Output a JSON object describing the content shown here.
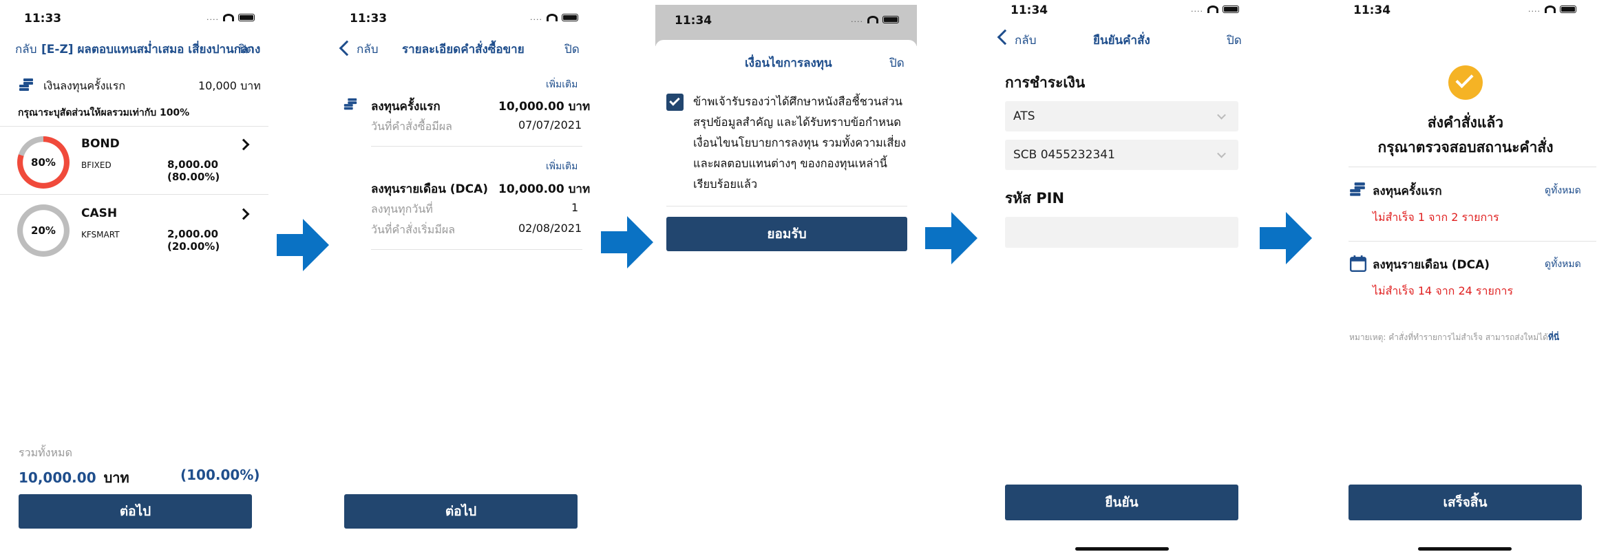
{
  "screen1": {
    "time": "11:33",
    "back": "กลับ",
    "title": "[E-Z] ผลตอบแทนสม่ำเสมอ เสี่ยงปานกลาง",
    "close": "ปิด",
    "initial_label": "เงินลงทุนครั้งแรก",
    "initial_value": "10,000 บาท",
    "instruction": "กรุณาระบุสัดส่วนให้ผลรวมเท่ากับ 100%",
    "funds": [
      {
        "name": "BOND",
        "code": "BFIXED",
        "amount": "8,000.00 (80.00%)",
        "percent_label": "80%",
        "fraction": 0.8,
        "color": "#f04a3b"
      },
      {
        "name": "CASH",
        "code": "KFSMART",
        "amount": "2,000.00 (20.00%)",
        "percent_label": "20%",
        "fraction": 0.2,
        "color": "#bdbdbd"
      }
    ],
    "total_label": "รวมทั้งหมด",
    "total_amount": "10,000.00",
    "total_unit": "บาท",
    "total_percent": "(100.00%)",
    "next_button": "ต่อไป"
  },
  "screen2": {
    "time": "11:33",
    "back": "กลับ",
    "title": "รายละเอียดคำสั่งซื้อขาย",
    "close": "ปิด",
    "more1": "เพิ่มเติม",
    "initial_title": "ลงทุนครั้งแรก",
    "initial_amount": "10,000.00 บาท",
    "initial_date_label": "วันที่คำสั่งซื้อมีผล",
    "initial_date": "07/07/2021",
    "more2": "เพิ่มเติม",
    "dca_title": "ลงทุนรายเดือน (DCA)",
    "dca_amount": "10,000.00 บาท",
    "dca_day_label": "ลงทุนทุกวันที่",
    "dca_day": "1",
    "dca_date_label": "วันที่คำสั่งเริ่มมีผล",
    "dca_date": "02/08/2021",
    "next_button": "ต่อไป"
  },
  "screen3": {
    "time": "11:34",
    "title": "เงื่อนไขการลงทุน",
    "close": "ปิด",
    "checked": true,
    "terms": [
      "ข้าพเจ้ารับรองว่าได้ศึกษาหนังสือชี้ชวนส่วน",
      "สรุปข้อมูลสำคัญ และได้รับทราบข้อกำหนด",
      "เงื่อนไขนโยบายการลงทุน รวมทั้งความเสี่ยง",
      "และผลตอบแทนต่างๆ ของกองทุนเหล่านี้",
      "เรียบร้อยแล้ว"
    ],
    "accept_button": "ยอมรับ"
  },
  "screen4": {
    "time": "11:34",
    "back": "กลับ",
    "title": "ยืนยันคำสั่ง",
    "close": "ปิด",
    "payment_heading": "การชำระเงิน",
    "payment_method": "ATS",
    "bank_account": "SCB 0455232341",
    "pin_heading": "รหัส PIN",
    "pin_value": "",
    "confirm_button": "ยืนยัน"
  },
  "screen5": {
    "time": "11:34",
    "heading_line1": "ส่งคำสั่งแล้ว",
    "heading_line2": "กรุณาตรวจสอบสถานะคำสั่ง",
    "item1_title": "ลงทุนครั้งแรก",
    "item1_link": "ดูทั้งหมด",
    "item1_status": "ไม่สำเร็จ 1 จาก 2 รายการ",
    "item2_title": "ลงทุนรายเดือน (DCA)",
    "item2_link": "ดูทั้งหมด",
    "item2_status": "ไม่สำเร็จ 14 จาก 24 รายการ",
    "note": "หมายเหตุ: คำสั่งที่ทำรายการไม่สำเร็จ สามารถส่งใหม่ได้",
    "note_link": "ที่นี่",
    "finish_button": "เสร็จสิ้น"
  },
  "colors": {
    "navy": "#22466f",
    "link_blue": "#1f4e8c",
    "arrow_blue": "#0a72c4",
    "error_red": "#e02020",
    "success_orange": "#f5b325"
  }
}
